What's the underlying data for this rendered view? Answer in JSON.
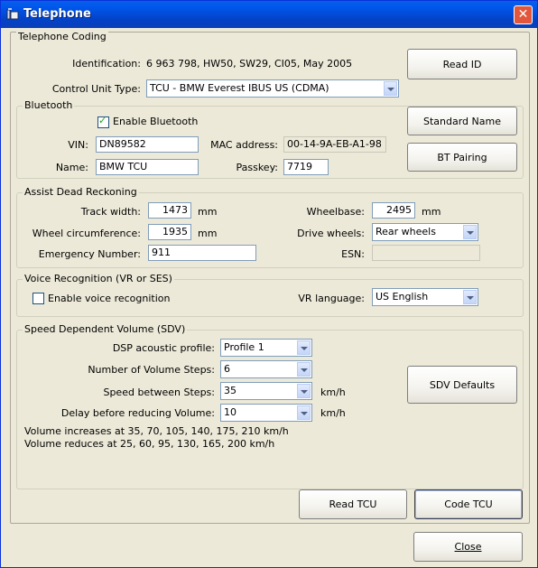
{
  "window": {
    "title": "Telephone"
  },
  "coding": {
    "legend": "Telephone Coding",
    "identification_label": "Identification:",
    "identification_value": "6 963 798,  HW50,  SW29,  CI05,  May 2005",
    "control_unit_label": "Control Unit Type:",
    "control_unit_value": "TCU - BMW Everest IBUS US (CDMA)",
    "read_id": "Read ID"
  },
  "bluetooth": {
    "legend": "Bluetooth",
    "enable_label": "Enable Bluetooth",
    "enable_checked": true,
    "vin_label": "VIN:",
    "vin_value": "DN89582",
    "name_label": "Name:",
    "name_value": "BMW TCU",
    "mac_label": "MAC address:",
    "mac_value": "00-14-9A-EB-A1-98",
    "passkey_label": "Passkey:",
    "passkey_value": "7719",
    "standard_name": "Standard Name",
    "bt_pairing": "BT Pairing"
  },
  "adr": {
    "legend": "Assist Dead Reckoning",
    "track_label": "Track width:",
    "track_value": "1473",
    "track_unit": "mm",
    "wheel_circ_label": "Wheel circumference:",
    "wheel_circ_value": "1935",
    "wheel_circ_unit": "mm",
    "emergency_label": "Emergency Number:",
    "emergency_value": "911",
    "wheelbase_label": "Wheelbase:",
    "wheelbase_value": "2495",
    "wheelbase_unit": "mm",
    "drive_label": "Drive wheels:",
    "drive_value": "Rear wheels",
    "esn_label": "ESN:",
    "esn_value": ""
  },
  "voice": {
    "legend": "Voice Recognition (VR or SES)",
    "enable_label": "Enable voice recognition",
    "enable_checked": false,
    "lang_label": "VR language:",
    "lang_value": "US English"
  },
  "sdv": {
    "legend": "Speed Dependent Volume (SDV)",
    "dsp_label": "DSP acoustic profile:",
    "dsp_value": "Profile 1",
    "steps_label": "Number of Volume Steps:",
    "steps_value": "6",
    "speed_label": "Speed between Steps:",
    "speed_value": "35",
    "speed_unit": "km/h",
    "delay_label": "Delay before reducing Volume:",
    "delay_value": "10",
    "delay_unit": "km/h",
    "increase_text": "Volume increases at 35, 70, 105, 140, 175, 210 km/h",
    "reduce_text": "Volume reduces at 25, 60, 95, 130, 165, 200 km/h",
    "defaults": "SDV Defaults"
  },
  "actions": {
    "read_tcu": "Read TCU",
    "code_tcu": "Code TCU",
    "close": "Close"
  }
}
